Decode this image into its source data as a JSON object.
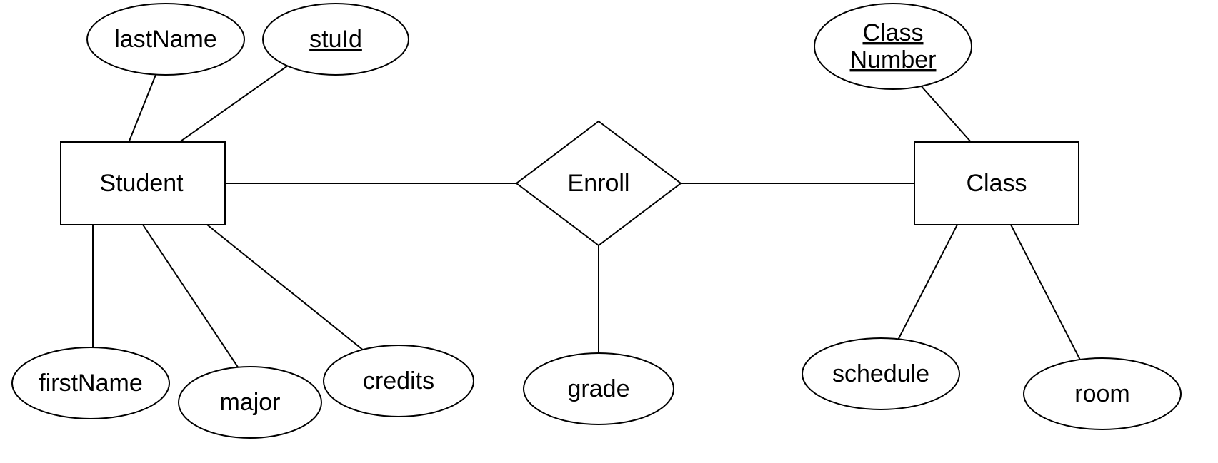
{
  "entities": {
    "student": {
      "name": "Student",
      "attributes": {
        "lastName": {
          "label": "lastName",
          "key": false
        },
        "stuId": {
          "label": "stuId",
          "key": true
        },
        "firstName": {
          "label": "firstName",
          "key": false
        },
        "major": {
          "label": "major",
          "key": false
        },
        "credits": {
          "label": "credits",
          "key": false
        }
      }
    },
    "class": {
      "name": "Class",
      "attributes": {
        "classNumber": {
          "label_line1": "Class",
          "label_line2": "Number",
          "key": true
        },
        "schedule": {
          "label": "schedule",
          "key": false
        },
        "room": {
          "label": "room",
          "key": false
        }
      }
    }
  },
  "relationships": {
    "enroll": {
      "name": "Enroll",
      "attributes": {
        "grade": {
          "label": "grade",
          "key": false
        }
      }
    }
  }
}
